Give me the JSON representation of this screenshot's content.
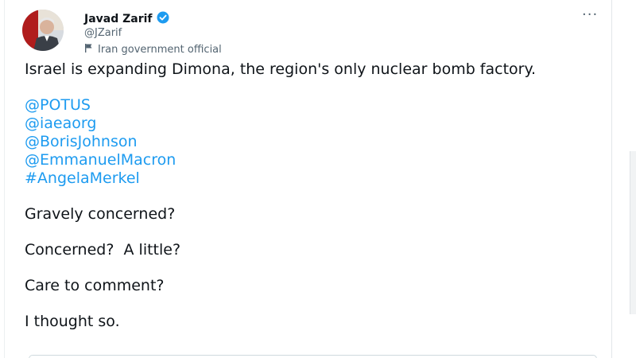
{
  "user": {
    "name": "Javad Zarif",
    "handle": "@JZarif",
    "label": "Iran government official"
  },
  "icons": {
    "verified": "verified-badge-icon",
    "label_flag": "flag-icon",
    "more": "more-options-icon"
  },
  "more_glyph": "···",
  "tweet": {
    "intro": "Israel is expanding Dimona, the region's only nuclear bomb factory.",
    "mentions": [
      "@POTUS",
      "@iaeaorg",
      "@BorisJohnson",
      "@EmmanuelMacron",
      "#AngelaMerkel"
    ],
    "lines": [
      "Gravely concerned?",
      "Concerned?  A little?",
      "Care to comment?",
      "I thought so."
    ]
  },
  "colors": {
    "link": "#1d9bf0",
    "text": "#0f1419",
    "muted": "#536471",
    "verified": "#1d9bf0"
  }
}
